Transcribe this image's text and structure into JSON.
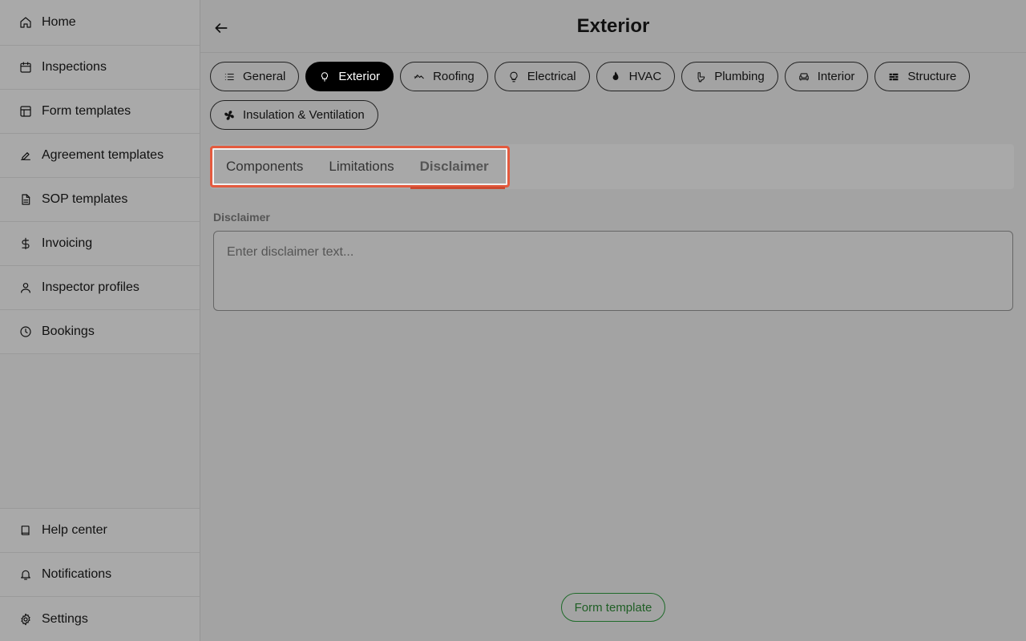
{
  "sidebar": {
    "top_items": [
      {
        "label": "Home",
        "icon": "home-icon"
      },
      {
        "label": "Inspections",
        "icon": "calendar-icon"
      },
      {
        "label": "Form templates",
        "icon": "layout-icon"
      },
      {
        "label": "Agreement templates",
        "icon": "signature-icon"
      },
      {
        "label": "SOP templates",
        "icon": "document-icon"
      },
      {
        "label": "Invoicing",
        "icon": "dollar-icon"
      },
      {
        "label": "Inspector profiles",
        "icon": "user-icon"
      },
      {
        "label": "Bookings",
        "icon": "clock-icon"
      }
    ],
    "bottom_items": [
      {
        "label": "Help center",
        "icon": "book-icon"
      },
      {
        "label": "Notifications",
        "icon": "bell-icon"
      },
      {
        "label": "Settings",
        "icon": "gear-icon"
      }
    ]
  },
  "header": {
    "title": "Exterior",
    "back_icon": "arrow-left-icon"
  },
  "categories": [
    {
      "label": "General",
      "icon": "list-icon",
      "active": false
    },
    {
      "label": "Exterior",
      "icon": "tree-icon",
      "active": true
    },
    {
      "label": "Roofing",
      "icon": "roof-icon",
      "active": false
    },
    {
      "label": "Electrical",
      "icon": "lightbulb-icon",
      "active": false
    },
    {
      "label": "HVAC",
      "icon": "flame-icon",
      "active": false
    },
    {
      "label": "Plumbing",
      "icon": "toilet-icon",
      "active": false
    },
    {
      "label": "Interior",
      "icon": "sofa-icon",
      "active": false
    },
    {
      "label": "Structure",
      "icon": "brick-icon",
      "active": false
    },
    {
      "label": "Insulation & Ventilation",
      "icon": "fan-icon",
      "active": false
    }
  ],
  "tabs": [
    {
      "label": "Components",
      "active": false
    },
    {
      "label": "Limitations",
      "active": false
    },
    {
      "label": "Disclaimer",
      "active": true
    }
  ],
  "disclaimer": {
    "label": "Disclaimer",
    "placeholder": "Enter disclaimer text...",
    "value": ""
  },
  "footer": {
    "button_label": "Form template"
  },
  "colors": {
    "highlight_border": "#e45a3e",
    "active_chip_bg": "#000000",
    "footer_button": "#1f6b2a"
  }
}
